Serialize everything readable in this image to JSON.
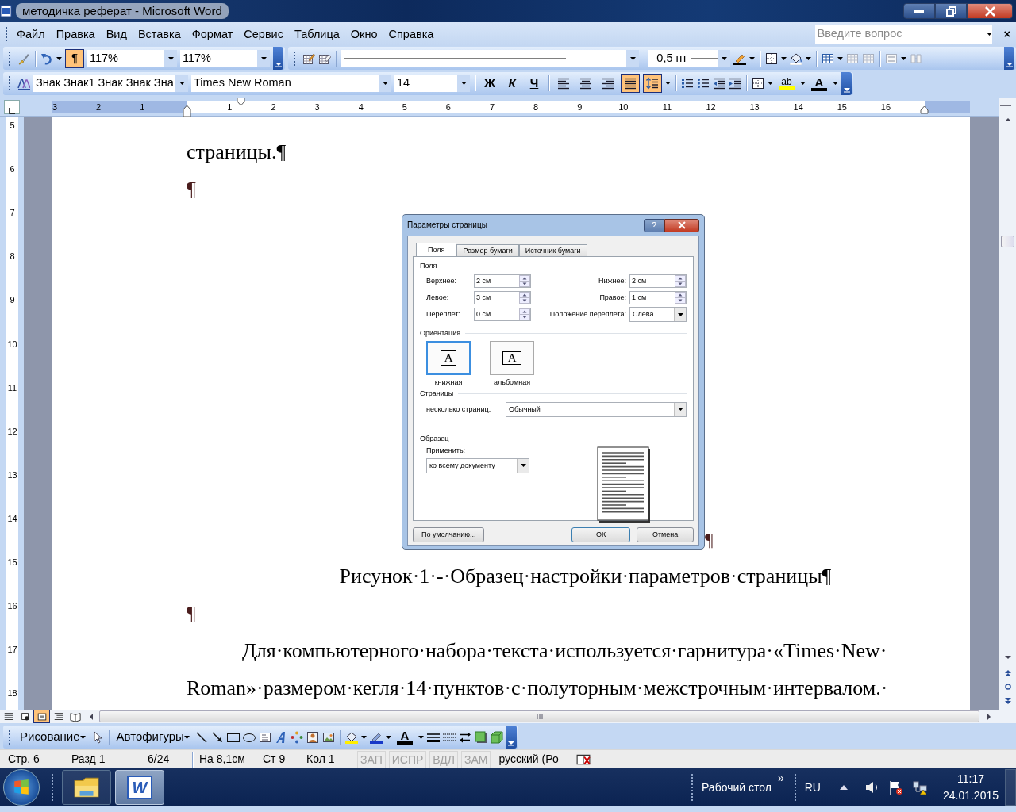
{
  "window": {
    "title": "методичка реферат - Microsoft Word"
  },
  "menu": [
    "Файл",
    "Правка",
    "Вид",
    "Вставка",
    "Формат",
    "Сервис",
    "Таблица",
    "Окно",
    "Справка"
  ],
  "help_search": {
    "placeholder": "Введите вопрос",
    "close": "×"
  },
  "standard_toolbar": {
    "show_marks": {
      "label": "¶",
      "on": true
    },
    "zoom": [
      "117%",
      "117%"
    ]
  },
  "tables_toolbar": {
    "line_weight": "0,5 пт"
  },
  "formatting_toolbar": {
    "style": "Знак Знак1 Знак Знак Зна",
    "font": "Times New Roman",
    "size": "14",
    "bold": "Ж",
    "italic": "К",
    "underline": "Ч",
    "alignment": [
      {
        "selected": false
      },
      {
        "selected": false
      },
      {
        "selected": false
      },
      {
        "selected": true
      }
    ],
    "line_spacing_on": true,
    "highlight_label": "ab",
    "font_color_label": "A"
  },
  "ruler": {
    "left_marks": [
      "3",
      "2",
      "1"
    ],
    "marks": [
      "1",
      "2",
      "3",
      "4",
      "5",
      "6",
      "7",
      "8",
      "9",
      "10",
      "11",
      "12",
      "13",
      "14",
      "15",
      "16"
    ]
  },
  "vertical_ruler": {
    "marks": [
      "5",
      "6",
      "7",
      "8",
      "9",
      "10",
      "11",
      "12",
      "13",
      "14",
      "15",
      "16",
      "17",
      "18"
    ]
  },
  "document": [
    {
      "kind": "text",
      "text": "страницы.¶"
    },
    {
      "kind": "mark",
      "text": "¶"
    },
    {
      "kind": "figure",
      "trailing": "¶"
    },
    {
      "kind": "caption",
      "text": "Рисунок·1·-·Образец·настройки·параметров·страницы¶"
    },
    {
      "kind": "mark",
      "text": "¶"
    },
    {
      "kind": "paragraph",
      "text": "Для·компьютерного·набора·текста·используется·гарнитура·«Times·New·Roman»·размером·кегля·14·пунктов·с·полуторным·межстрочным·интервалом.·"
    }
  ],
  "dialog": {
    "title": "Параметры страницы",
    "help": "?",
    "tabs": [
      {
        "label": "Поля",
        "selected": true
      },
      {
        "label": "Размер бумаги",
        "selected": false
      },
      {
        "label": "Источник бумаги",
        "selected": false
      }
    ],
    "margins_heading": "Поля",
    "margins": [
      {
        "label": "Верхнее:",
        "value": "2 см",
        "kind": "spin"
      },
      {
        "label": "Нижнее:",
        "value": "2 см",
        "kind": "spin"
      },
      {
        "label": "Левое:",
        "value": "3 см",
        "kind": "spin"
      },
      {
        "label": "Правое:",
        "value": "1 см",
        "kind": "spin"
      },
      {
        "label": "Переплет:",
        "value": "0 см",
        "kind": "spin"
      },
      {
        "label": "Положение переплета:",
        "value": "Слева",
        "kind": "select"
      }
    ],
    "orientation_heading": "Ориентация",
    "orientation": [
      {
        "label": "книжная",
        "letter": "A",
        "kind": "portrait",
        "selected": true
      },
      {
        "label": "альбомная",
        "letter": "A",
        "kind": "landscape",
        "selected": false
      }
    ],
    "pages_heading": "Страницы",
    "pages_label": "несколько страниц:",
    "pages_value": "Обычный",
    "sample_heading": "Образец",
    "apply_label": "Применить:",
    "apply_value": "ко всему документу",
    "buttons": [
      {
        "label": "По умолчанию...",
        "kind": "default"
      },
      {
        "label": "ОК",
        "kind": "ok"
      },
      {
        "label": "Отмена",
        "kind": "cancel"
      }
    ]
  },
  "view_buttons": [
    {
      "selected": false
    },
    {
      "selected": false
    },
    {
      "selected": true
    },
    {
      "selected": false
    },
    {
      "selected": false
    }
  ],
  "drawing_toolbar": {
    "drawing": "Рисование",
    "autoshapes": "Автофигуры",
    "font_color_label": "A"
  },
  "status_bar": {
    "cells": [
      "Стр. 6",
      "Разд 1",
      "6/24",
      "На 8,1см",
      "Ст 9",
      "Кол 1"
    ],
    "modes": [
      {
        "label": "ЗАП",
        "disabled": true
      },
      {
        "label": "ИСПР",
        "disabled": true
      },
      {
        "label": "ВДЛ",
        "disabled": true
      },
      {
        "label": "ЗАМ",
        "disabled": true
      }
    ],
    "language": "русский (Ро"
  },
  "taskbar": {
    "apps": [
      {
        "kind": "folder",
        "selected": false
      },
      {
        "kind": "word",
        "label": "W",
        "selected": true
      }
    ],
    "toolbar_label": "Рабочий стол",
    "chevron": "»",
    "language": "RU",
    "time": "11:17",
    "date": "24.01.2015"
  }
}
